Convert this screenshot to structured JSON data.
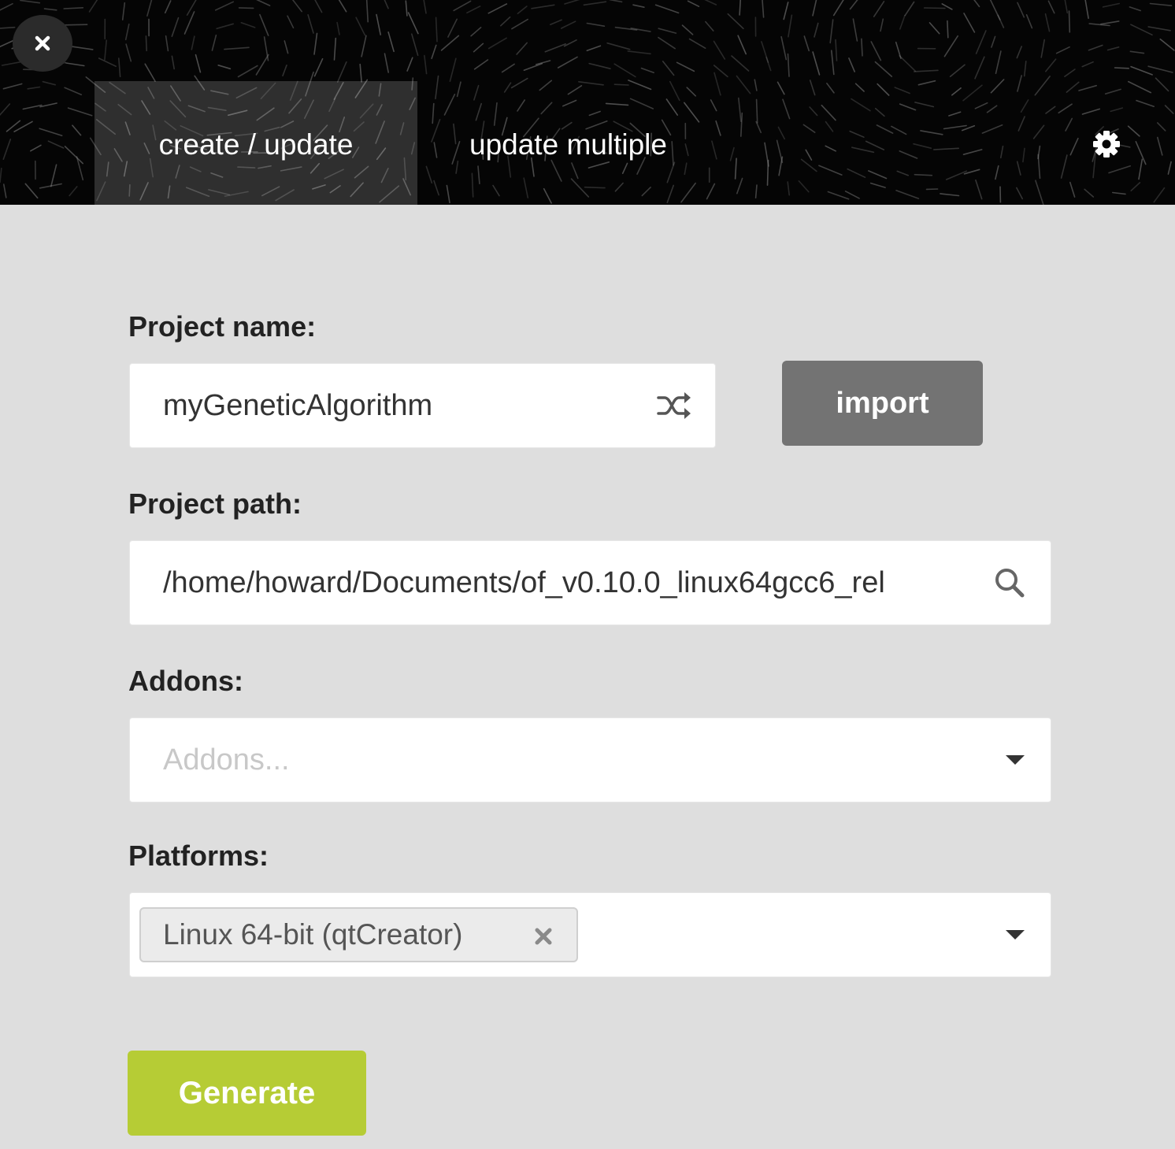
{
  "header": {
    "close_icon": "close-icon",
    "tabs": [
      {
        "label": "create / update",
        "active": true
      },
      {
        "label": "update multiple",
        "active": false
      }
    ],
    "settings_icon": "gear-icon"
  },
  "form": {
    "project_name": {
      "label": "Project name:",
      "value": "myGeneticAlgorithm",
      "icon": "shuffle-icon"
    },
    "import_label": "import",
    "project_path": {
      "label": "Project path:",
      "value": "/home/howard/Documents/of_v0.10.0_linux64gcc6_rel",
      "icon": "search-icon"
    },
    "addons": {
      "label": "Addons:",
      "placeholder": "Addons...",
      "icon": "caret-down-icon"
    },
    "platforms": {
      "label": "Platforms:",
      "selected": [
        "Linux 64-bit (qtCreator)"
      ],
      "icon": "caret-down-icon"
    },
    "generate_label": "Generate"
  },
  "colors": {
    "header_bg": "#050505",
    "body_bg": "#dedede",
    "import_bg": "#737373",
    "generate_bg": "#b6cc35"
  }
}
